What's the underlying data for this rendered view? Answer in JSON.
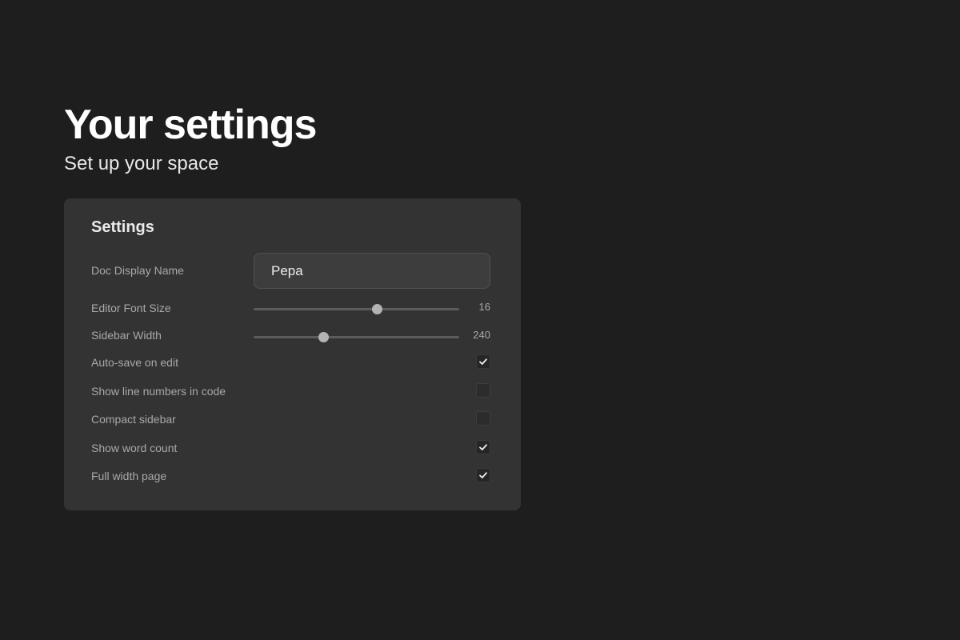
{
  "header": {
    "title": "Your settings",
    "subtitle": "Set up your space"
  },
  "settings": {
    "title": "Settings",
    "display_name": {
      "label": "Doc Display Name",
      "value": "Pepa"
    },
    "editor_font_size": {
      "label": "Editor Font Size",
      "value": "16",
      "fill_percent": 60
    },
    "sidebar_width": {
      "label": "Sidebar Width",
      "value": "240",
      "fill_percent": 34
    },
    "toggles": [
      {
        "label": "Auto-save on edit",
        "checked": true
      },
      {
        "label": "Show line numbers in code",
        "checked": false
      },
      {
        "label": "Compact sidebar",
        "checked": false
      },
      {
        "label": "Show word count",
        "checked": true
      },
      {
        "label": "Full width page",
        "checked": true
      }
    ]
  },
  "colors": {
    "background": "#1e1e1e",
    "card": "#333333",
    "text_primary": "#ffffff",
    "text_muted": "#a8a8a8"
  }
}
